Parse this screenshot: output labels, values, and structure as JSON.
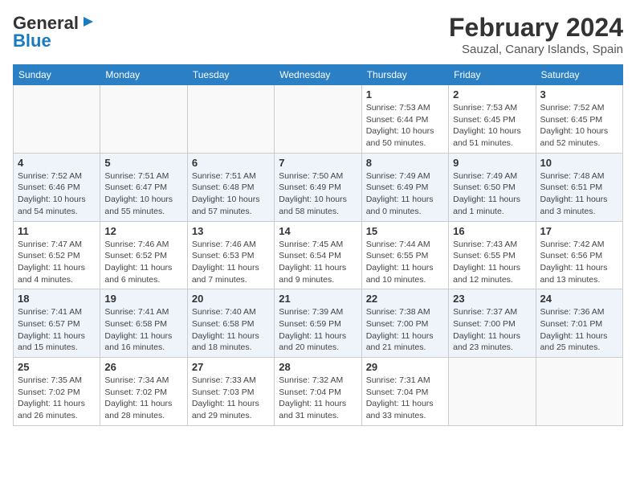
{
  "header": {
    "logo_general": "General",
    "logo_blue": "Blue",
    "month_year": "February 2024",
    "location": "Sauzal, Canary Islands, Spain"
  },
  "days_of_week": [
    "Sunday",
    "Monday",
    "Tuesday",
    "Wednesday",
    "Thursday",
    "Friday",
    "Saturday"
  ],
  "weeks": [
    [
      {
        "day": "",
        "info": ""
      },
      {
        "day": "",
        "info": ""
      },
      {
        "day": "",
        "info": ""
      },
      {
        "day": "",
        "info": ""
      },
      {
        "day": "1",
        "info": "Sunrise: 7:53 AM\nSunset: 6:44 PM\nDaylight: 10 hours\nand 50 minutes."
      },
      {
        "day": "2",
        "info": "Sunrise: 7:53 AM\nSunset: 6:45 PM\nDaylight: 10 hours\nand 51 minutes."
      },
      {
        "day": "3",
        "info": "Sunrise: 7:52 AM\nSunset: 6:45 PM\nDaylight: 10 hours\nand 52 minutes."
      }
    ],
    [
      {
        "day": "4",
        "info": "Sunrise: 7:52 AM\nSunset: 6:46 PM\nDaylight: 10 hours\nand 54 minutes."
      },
      {
        "day": "5",
        "info": "Sunrise: 7:51 AM\nSunset: 6:47 PM\nDaylight: 10 hours\nand 55 minutes."
      },
      {
        "day": "6",
        "info": "Sunrise: 7:51 AM\nSunset: 6:48 PM\nDaylight: 10 hours\nand 57 minutes."
      },
      {
        "day": "7",
        "info": "Sunrise: 7:50 AM\nSunset: 6:49 PM\nDaylight: 10 hours\nand 58 minutes."
      },
      {
        "day": "8",
        "info": "Sunrise: 7:49 AM\nSunset: 6:49 PM\nDaylight: 11 hours\nand 0 minutes."
      },
      {
        "day": "9",
        "info": "Sunrise: 7:49 AM\nSunset: 6:50 PM\nDaylight: 11 hours\nand 1 minute."
      },
      {
        "day": "10",
        "info": "Sunrise: 7:48 AM\nSunset: 6:51 PM\nDaylight: 11 hours\nand 3 minutes."
      }
    ],
    [
      {
        "day": "11",
        "info": "Sunrise: 7:47 AM\nSunset: 6:52 PM\nDaylight: 11 hours\nand 4 minutes."
      },
      {
        "day": "12",
        "info": "Sunrise: 7:46 AM\nSunset: 6:52 PM\nDaylight: 11 hours\nand 6 minutes."
      },
      {
        "day": "13",
        "info": "Sunrise: 7:46 AM\nSunset: 6:53 PM\nDaylight: 11 hours\nand 7 minutes."
      },
      {
        "day": "14",
        "info": "Sunrise: 7:45 AM\nSunset: 6:54 PM\nDaylight: 11 hours\nand 9 minutes."
      },
      {
        "day": "15",
        "info": "Sunrise: 7:44 AM\nSunset: 6:55 PM\nDaylight: 11 hours\nand 10 minutes."
      },
      {
        "day": "16",
        "info": "Sunrise: 7:43 AM\nSunset: 6:55 PM\nDaylight: 11 hours\nand 12 minutes."
      },
      {
        "day": "17",
        "info": "Sunrise: 7:42 AM\nSunset: 6:56 PM\nDaylight: 11 hours\nand 13 minutes."
      }
    ],
    [
      {
        "day": "18",
        "info": "Sunrise: 7:41 AM\nSunset: 6:57 PM\nDaylight: 11 hours\nand 15 minutes."
      },
      {
        "day": "19",
        "info": "Sunrise: 7:41 AM\nSunset: 6:58 PM\nDaylight: 11 hours\nand 16 minutes."
      },
      {
        "day": "20",
        "info": "Sunrise: 7:40 AM\nSunset: 6:58 PM\nDaylight: 11 hours\nand 18 minutes."
      },
      {
        "day": "21",
        "info": "Sunrise: 7:39 AM\nSunset: 6:59 PM\nDaylight: 11 hours\nand 20 minutes."
      },
      {
        "day": "22",
        "info": "Sunrise: 7:38 AM\nSunset: 7:00 PM\nDaylight: 11 hours\nand 21 minutes."
      },
      {
        "day": "23",
        "info": "Sunrise: 7:37 AM\nSunset: 7:00 PM\nDaylight: 11 hours\nand 23 minutes."
      },
      {
        "day": "24",
        "info": "Sunrise: 7:36 AM\nSunset: 7:01 PM\nDaylight: 11 hours\nand 25 minutes."
      }
    ],
    [
      {
        "day": "25",
        "info": "Sunrise: 7:35 AM\nSunset: 7:02 PM\nDaylight: 11 hours\nand 26 minutes."
      },
      {
        "day": "26",
        "info": "Sunrise: 7:34 AM\nSunset: 7:02 PM\nDaylight: 11 hours\nand 28 minutes."
      },
      {
        "day": "27",
        "info": "Sunrise: 7:33 AM\nSunset: 7:03 PM\nDaylight: 11 hours\nand 29 minutes."
      },
      {
        "day": "28",
        "info": "Sunrise: 7:32 AM\nSunset: 7:04 PM\nDaylight: 11 hours\nand 31 minutes."
      },
      {
        "day": "29",
        "info": "Sunrise: 7:31 AM\nSunset: 7:04 PM\nDaylight: 11 hours\nand 33 minutes."
      },
      {
        "day": "",
        "info": ""
      },
      {
        "day": "",
        "info": ""
      }
    ]
  ]
}
